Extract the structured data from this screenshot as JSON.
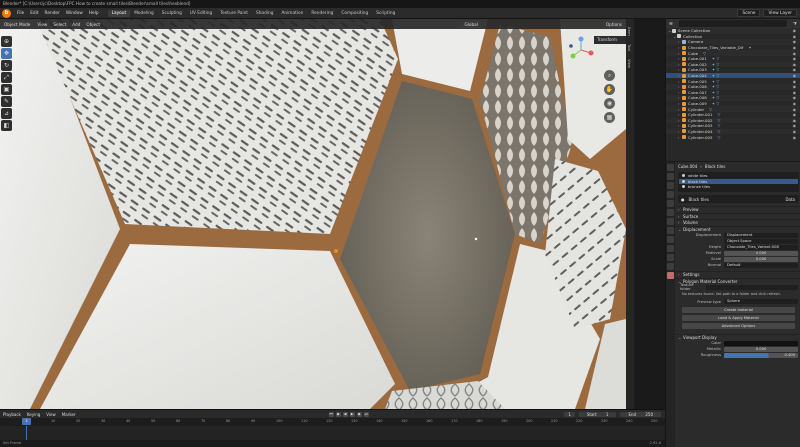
{
  "window": {
    "title": "Blender* [C:\\Users\\jc\\Desktop\\FPC How to create small tiles\\Blender\\small tiles\\hexblend]"
  },
  "topbar": {
    "logo": "b",
    "menus": [
      "File",
      "Edit",
      "Render",
      "Window",
      "Help"
    ],
    "workspaces": [
      "Layout",
      "Modeling",
      "Sculpting",
      "UV Editing",
      "Texture Paint",
      "Shading",
      "Animation",
      "Rendering",
      "Compositing",
      "Scripting"
    ],
    "active_workspace": "Layout",
    "scene": "Scene",
    "view_layer": "View Layer"
  },
  "viewport": {
    "header": {
      "mode": "Object Mode",
      "view": "View",
      "select": "Select",
      "add": "Add",
      "object": "Object",
      "orientation": "Global",
      "options": "Options"
    },
    "n_panel_tab": "Transform",
    "side_tabs": [
      "Item",
      "Tool",
      "View"
    ],
    "tools": [
      "cursor-icon",
      "move-icon",
      "rotate-icon",
      "scale-icon",
      "transform-icon",
      "annotate-icon",
      "measure-icon",
      "add-cube-icon"
    ],
    "colors": {
      "grout": "#a36a3a",
      "tile_white": "#e9e9e6",
      "tile_concrete": "#6b6559",
      "pattern_stroke": "#5a5a5a"
    }
  },
  "outliner": {
    "search_placeholder": "",
    "rows": [
      {
        "name": "Scene Collection",
        "type": "coll",
        "indent": 0
      },
      {
        "name": "Collection",
        "type": "coll",
        "indent": 1
      },
      {
        "name": "Camera",
        "type": "cam",
        "indent": 2,
        "mods": ""
      },
      {
        "name": "Chocolate_Tiles_Variable_Dif",
        "type": "obj",
        "indent": 2,
        "mods": "✦"
      },
      {
        "name": "Cube",
        "type": "obj",
        "indent": 2,
        "mods": "▽"
      },
      {
        "name": "Cube.001",
        "type": "obj",
        "indent": 2,
        "mods": "✦ ▽"
      },
      {
        "name": "Cube.002",
        "type": "obj",
        "indent": 2,
        "mods": "✦ ▽"
      },
      {
        "name": "Cube.003",
        "type": "obj",
        "indent": 2,
        "mods": "✦ ▽"
      },
      {
        "name": "Cube.004",
        "type": "obj",
        "indent": 2,
        "mods": "✦ ▽"
      },
      {
        "name": "Cube.005",
        "type": "obj",
        "indent": 2,
        "mods": "✦ ▽"
      },
      {
        "name": "Cube.006",
        "type": "obj",
        "indent": 2,
        "mods": "✦ ▽"
      },
      {
        "name": "Cube.007",
        "type": "obj",
        "indent": 2,
        "mods": "✦ ▽"
      },
      {
        "name": "Cube.008",
        "type": "obj",
        "indent": 2,
        "mods": "✦ ▽"
      },
      {
        "name": "Cube.009",
        "type": "obj",
        "indent": 2,
        "mods": "✦ ▽"
      },
      {
        "name": "Cylinder",
        "type": "obj",
        "indent": 2,
        "mods": "▽"
      },
      {
        "name": "Cylinder.001",
        "type": "obj",
        "indent": 2,
        "mods": "▽"
      },
      {
        "name": "Cylinder.002",
        "type": "obj",
        "indent": 2,
        "mods": "▽"
      },
      {
        "name": "Cylinder.003",
        "type": "obj",
        "indent": 2,
        "mods": "▽"
      },
      {
        "name": "Cylinder.004",
        "type": "obj",
        "indent": 2,
        "mods": "▽"
      },
      {
        "name": "Cylinder.005",
        "type": "obj",
        "indent": 2,
        "mods": "▽"
      }
    ]
  },
  "properties": {
    "object_name": "Cube.004",
    "material_name": "Black tiles",
    "slots": [
      "white tiles",
      "black tiles",
      "bronze tiles"
    ],
    "selected_slot": 1,
    "material_field": "Black tiles",
    "material_mode": "Data",
    "sections": {
      "preview": "Preview",
      "surface": "Surface",
      "volume": "Volume",
      "displacement": "Displacement",
      "settings": "Settings",
      "converter": "Polygon Material Converter",
      "viewport_display": "Viewport Display"
    },
    "displacement": {
      "disp_label": "Displacement",
      "disp_value": "Displacement",
      "type_value": "Object Space",
      "height_label": "Height",
      "height_value": "Chocolate_Tiles_Variant.008",
      "midlevel_label": "Midlevel",
      "midlevel_value": "0.000",
      "scale_label": "Scale",
      "scale_value": "0.000",
      "normal_label": "Normal",
      "normal_value": "Default"
    },
    "converter": {
      "texture_folder_label": "Texture folder",
      "note": "No textures found. Set path to a folder and click refresh.",
      "preview_label": "Preview type",
      "preview_value": "Sphere",
      "create_btn": "Create material",
      "load_btn": "Load & Apply Material",
      "advanced_btn": "Advanced Options"
    },
    "viewport_display": {
      "color_label": "Color",
      "metallic_label": "Metallic",
      "metallic_value": "0.000",
      "roughness_label": "Roughness",
      "roughness_value": "0.400"
    }
  },
  "timeline": {
    "menus": [
      "Playback",
      "Keying",
      "View",
      "Marker"
    ],
    "current_frame": "1",
    "start_label": "Start",
    "start_value": "1",
    "end_label": "End",
    "end_value": "250",
    "ruler": [
      "0",
      "10",
      "20",
      "30",
      "40",
      "50",
      "60",
      "70",
      "80",
      "90",
      "100",
      "110",
      "120",
      "130",
      "140",
      "150",
      "160",
      "170",
      "180",
      "190",
      "200",
      "210",
      "220",
      "230",
      "240",
      "250"
    ]
  },
  "statusbar": {
    "left": "Set Frame",
    "version": "2.92.0"
  }
}
